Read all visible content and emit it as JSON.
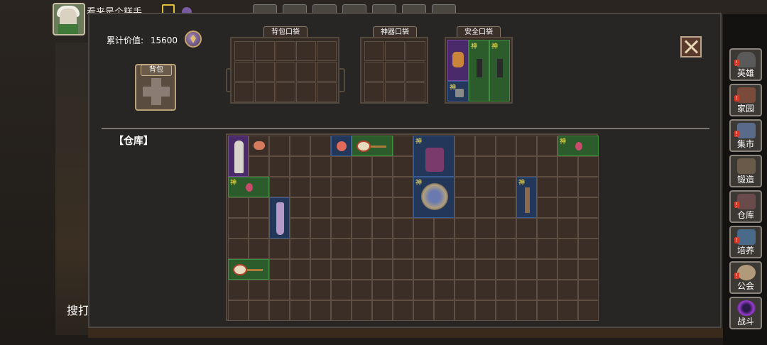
{
  "player": {
    "name": "看来是个糕手"
  },
  "inventory": {
    "accumulated_label": "累计价值:",
    "accumulated_value": "15600",
    "bag_button": "背包",
    "pockets": {
      "backpack": "背包口袋",
      "artifact": "神器口袋",
      "safe": "安全口袋"
    },
    "shen": "神",
    "warehouse_title": "【仓库】"
  },
  "search_label": "搜打",
  "side_menu": [
    {
      "label": "英雄",
      "icon": "helmet-icon"
    },
    {
      "label": "家园",
      "icon": "castle-icon"
    },
    {
      "label": "集市",
      "icon": "market-icon"
    },
    {
      "label": "锻造",
      "icon": "anvil-icon"
    },
    {
      "label": "仓库",
      "icon": "warehouse-icon"
    },
    {
      "label": "培养",
      "icon": "crystal-icon"
    },
    {
      "label": "公会",
      "icon": "guild-icon"
    },
    {
      "label": "战斗",
      "icon": "portal-icon"
    }
  ],
  "colors": {
    "rarity_green": "#2c5b2c",
    "rarity_blue": "#23375a",
    "rarity_purple": "#4b2a6b",
    "shen_yellow": "#ffe84a"
  }
}
